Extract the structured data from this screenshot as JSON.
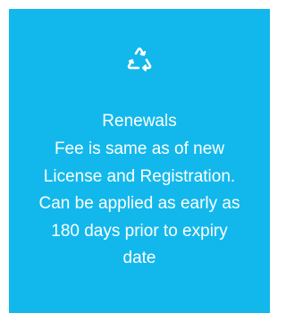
{
  "card": {
    "icon": "recycle-icon",
    "title": "Renewals",
    "description_lines": [
      "Fee is same as of new",
      "License and Registration.",
      "Can be applied as early as",
      "180 days prior to expiry",
      "date"
    ],
    "background_color": "#12b8ec",
    "text_color": "#ffffff"
  }
}
